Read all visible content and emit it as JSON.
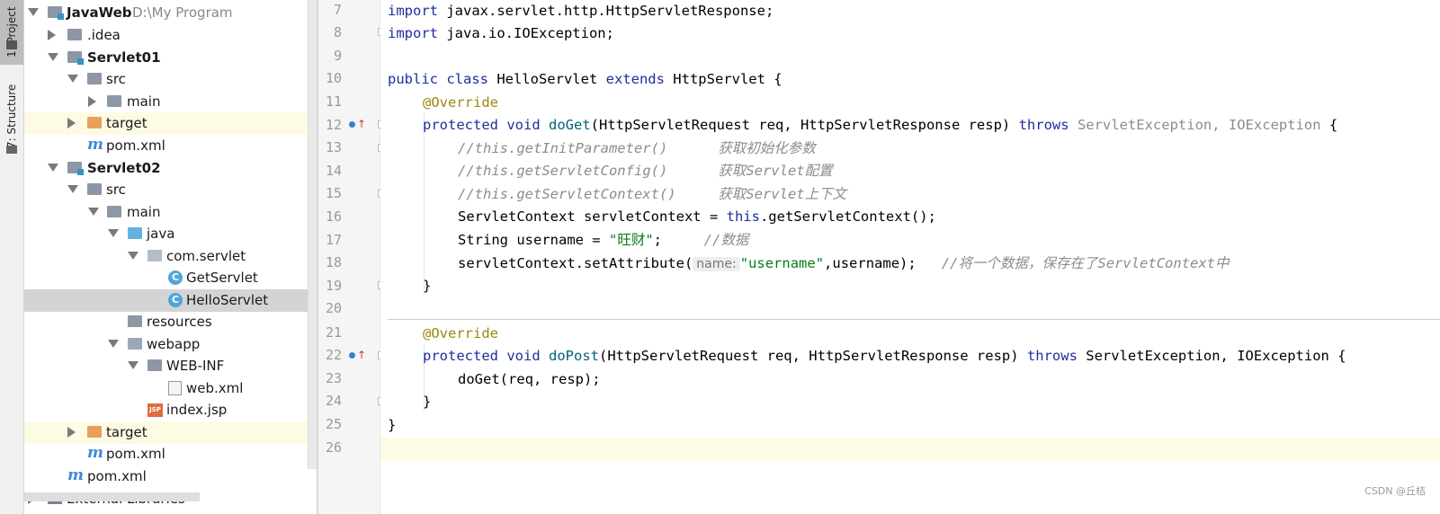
{
  "toolwindows": {
    "project_tab": "1: Project",
    "structure_tab": "7: Structure"
  },
  "tree": [
    {
      "label": "JavaWeb",
      "extra": "D:\\My                Program",
      "bold": true
    },
    {
      "label": ".idea"
    },
    {
      "label": "Servlet01",
      "bold": true
    },
    {
      "label": "src"
    },
    {
      "label": "main"
    },
    {
      "label": "target"
    },
    {
      "label": "pom.xml"
    },
    {
      "label": "Servlet02",
      "bold": true
    },
    {
      "label": "src"
    },
    {
      "label": "main"
    },
    {
      "label": "java"
    },
    {
      "label": "com.servlet"
    },
    {
      "label": "GetServlet"
    },
    {
      "label": "HelloServlet"
    },
    {
      "label": "resources"
    },
    {
      "label": "webapp"
    },
    {
      "label": "WEB-INF"
    },
    {
      "label": "web.xml"
    },
    {
      "label": "index.jsp"
    },
    {
      "label": "target"
    },
    {
      "label": "pom.xml"
    },
    {
      "label": "pom.xml"
    },
    {
      "label": "External Libraries"
    }
  ],
  "icon_text": {
    "maven": "m",
    "class": "C",
    "jsp": "JSP"
  },
  "editor": {
    "line_numbers": [
      "7",
      "8",
      "9",
      "10",
      "11",
      "12",
      "13",
      "14",
      "15",
      "16",
      "17",
      "18",
      "19",
      "20",
      "21",
      "22",
      "23",
      "24",
      "25",
      "26"
    ],
    "lines": {
      "l7": {
        "kw": "import",
        "rest": " javax.servlet.http.HttpServletResponse;"
      },
      "l8": {
        "kw": "import",
        "rest": " java.io.IOException;"
      },
      "l10": {
        "kw1": "public class",
        "name": " HelloServlet ",
        "kw2": "extends",
        "rest": " HttpServlet {"
      },
      "l11": {
        "ann": "@Override"
      },
      "l12": {
        "kw": "protected void",
        "fn": "doGet",
        "params": "(HttpServletRequest req, HttpServletResponse resp) ",
        "throws": "throws",
        "ex1": "ServletException",
        "comma": ", ",
        "ex2": "IOException",
        "end": " {"
      },
      "l13": {
        "cmt": "//this.getInitParameter()      获取初始化参数"
      },
      "l14": {
        "cmt": "//this.getServletConfig()      获取Servlet配置"
      },
      "l15": {
        "cmt": "//this.getServletContext()     获取Servlet上下文"
      },
      "l16": {
        "pre": "ServletContext servletContext = ",
        "kw": "this",
        "post": ".getServletContext();"
      },
      "l17": {
        "pre": "String username = ",
        "str": "\"旺财\"",
        "mid": ";     ",
        "cmt": "//数据"
      },
      "l18": {
        "pre": "servletContext.setAttribute(",
        "hint": "name:",
        "str": "\"username\"",
        "mid": ",username);   ",
        "cmt": "//将一个数据，保存在了ServletContext中"
      },
      "l19": {
        "text": "}"
      },
      "l21": {
        "ann": "@Override"
      },
      "l22": {
        "kw": "protected void",
        "fn": "doPost",
        "params": "(HttpServletRequest req, HttpServletResponse resp) ",
        "throws": "throws",
        "rest": " ServletException, IOException {"
      },
      "l23": {
        "text": "doGet(req, resp);"
      },
      "l24": {
        "text": "}"
      },
      "l25": {
        "text": "}"
      }
    }
  },
  "watermark": "CSDN @丘桔"
}
